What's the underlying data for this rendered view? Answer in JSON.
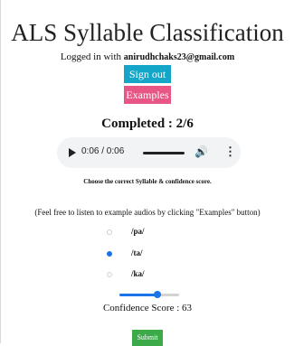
{
  "header": {
    "title": "ALS Syllable Classification",
    "logged_in_prefix": "Logged in with",
    "email": "anirudhchaks23@gmail.com"
  },
  "buttons": {
    "sign_out": "Sign out",
    "examples": "Examples",
    "submit": "Submit"
  },
  "progress": {
    "text": "Completed : 2/6"
  },
  "audio": {
    "time": "0:06 / 0:06",
    "progress_fraction": 1.0
  },
  "instructions": "Choose the correct Syllable & confidence score.",
  "note": "(Feel free to listen to example audios by clicking \"Examples\" button)",
  "options": [
    {
      "label": "/pa/",
      "selected": false
    },
    {
      "label": "/ta/",
      "selected": true
    },
    {
      "label": "/ka/",
      "selected": false
    }
  ],
  "confidence": {
    "value": 63,
    "max": 100,
    "label": "Confidence Score : 63"
  },
  "colors": {
    "sign_out": "#14a6c8",
    "examples": "#e75685",
    "submit": "#3daa4a",
    "accent": "#1a73e8"
  },
  "icons": [
    "play-icon",
    "volume-icon",
    "more-icon"
  ]
}
